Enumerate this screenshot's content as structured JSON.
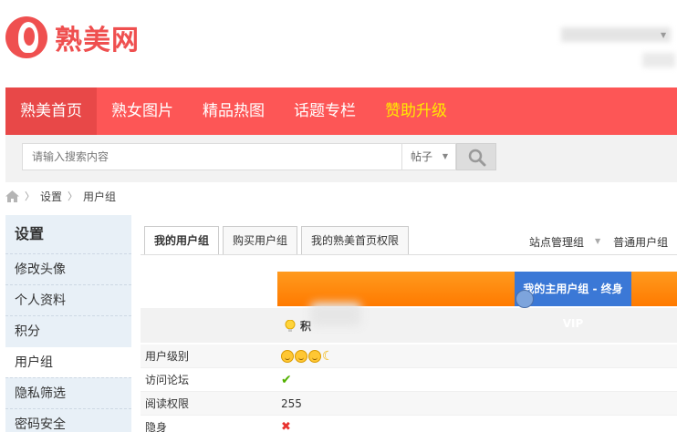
{
  "site": {
    "logo_text": "熟美网"
  },
  "nav": {
    "items": [
      {
        "label": "熟美首页",
        "active": true
      },
      {
        "label": "熟女图片"
      },
      {
        "label": "精品热图"
      },
      {
        "label": "话题专栏"
      },
      {
        "label": "赞助升级",
        "highlight": true
      }
    ]
  },
  "search": {
    "placeholder": "请输入搜索内容",
    "type_selected": "帖子",
    "button_icon": "search-icon"
  },
  "breadcrumb": {
    "items": [
      "设置",
      "用户组"
    ]
  },
  "sidebar": {
    "title": "设置",
    "items": [
      "修改头像",
      "个人资料",
      "积分",
      "用户组",
      "隐私筛选",
      "密码安全"
    ],
    "active_index": 3
  },
  "tabs": [
    {
      "label": "我的用户组",
      "active": true
    },
    {
      "label": "购买用户组"
    },
    {
      "label": "我的熟美首页权限"
    }
  ],
  "right_links": [
    "站点管理组",
    "普通用户组"
  ],
  "group": {
    "main_label": "我的主用户组 - 终身VIP",
    "credits_label": "积"
  },
  "permissions": [
    {
      "label": "用户级别",
      "type": "stars",
      "icons": [
        "sun",
        "sun",
        "sun",
        "moon"
      ]
    },
    {
      "label": "访问论坛",
      "type": "check"
    },
    {
      "label": "阅读权限",
      "type": "text",
      "value": "255"
    },
    {
      "label": "隐身",
      "type": "cross"
    }
  ],
  "colors": {
    "brand_red": "#fd5656",
    "nav_vip": "#ffea00",
    "group_orange": "#ff8a10",
    "group_blue": "#3b78d6"
  }
}
